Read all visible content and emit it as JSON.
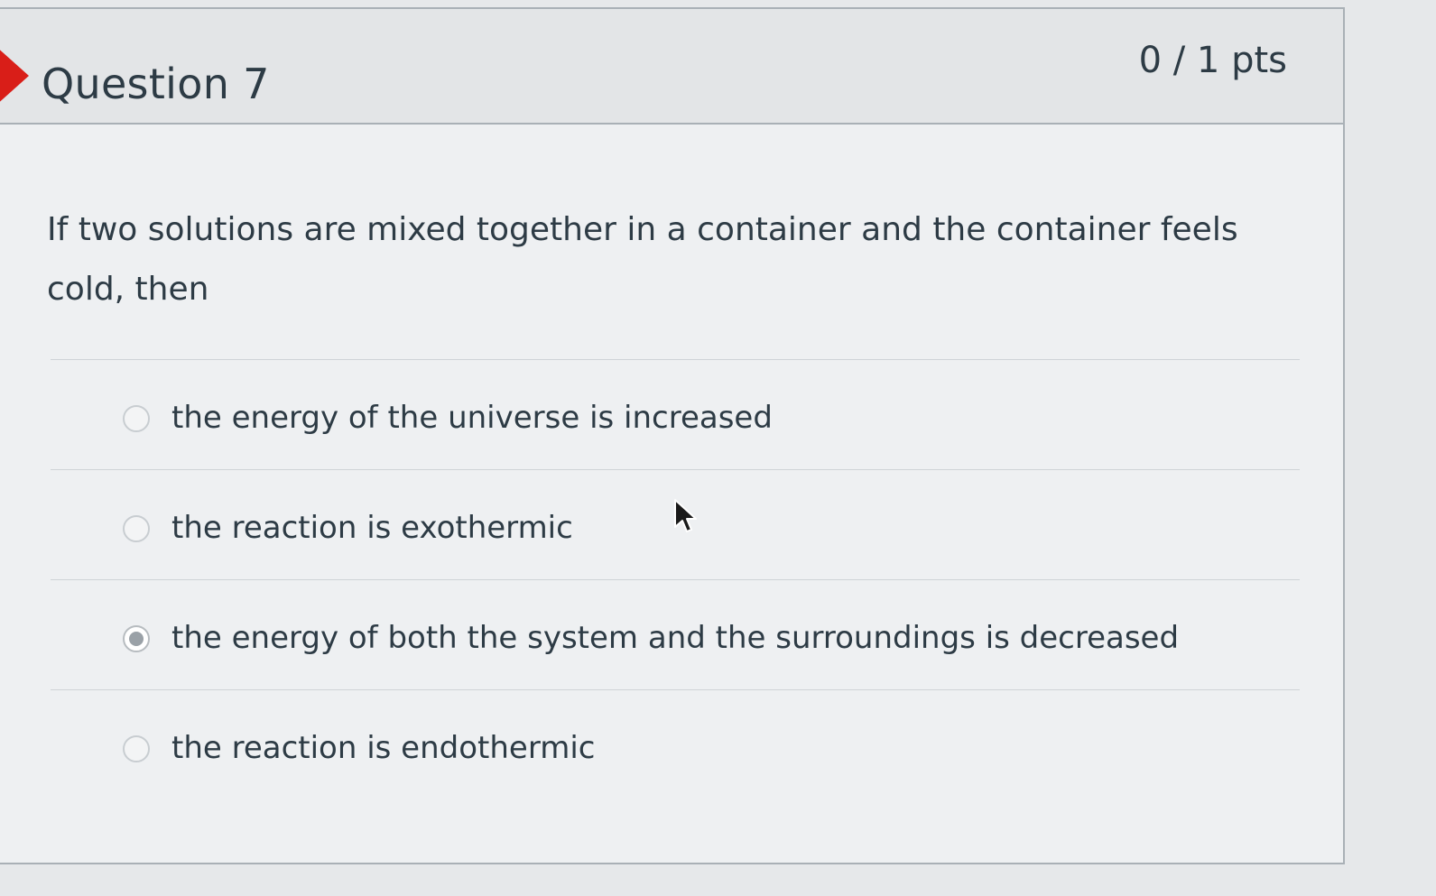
{
  "question": {
    "title": "Question 7",
    "points": "0 / 1 pts",
    "text": "If two solutions are mixed together in a container and the container feels cold, then",
    "status": "incorrect"
  },
  "answers": [
    {
      "label": "the energy of the universe is increased",
      "selected": false
    },
    {
      "label": "the reaction is exothermic",
      "selected": false
    },
    {
      "label": "the energy of both the system and the surroundings is decreased",
      "selected": true
    },
    {
      "label": "the reaction is endothermic",
      "selected": false
    }
  ],
  "colors": {
    "incorrect_flag": "#d91e18",
    "text": "#2d3b45",
    "header_bg": "#e3e5e7",
    "body_bg": "#eef0f2"
  }
}
